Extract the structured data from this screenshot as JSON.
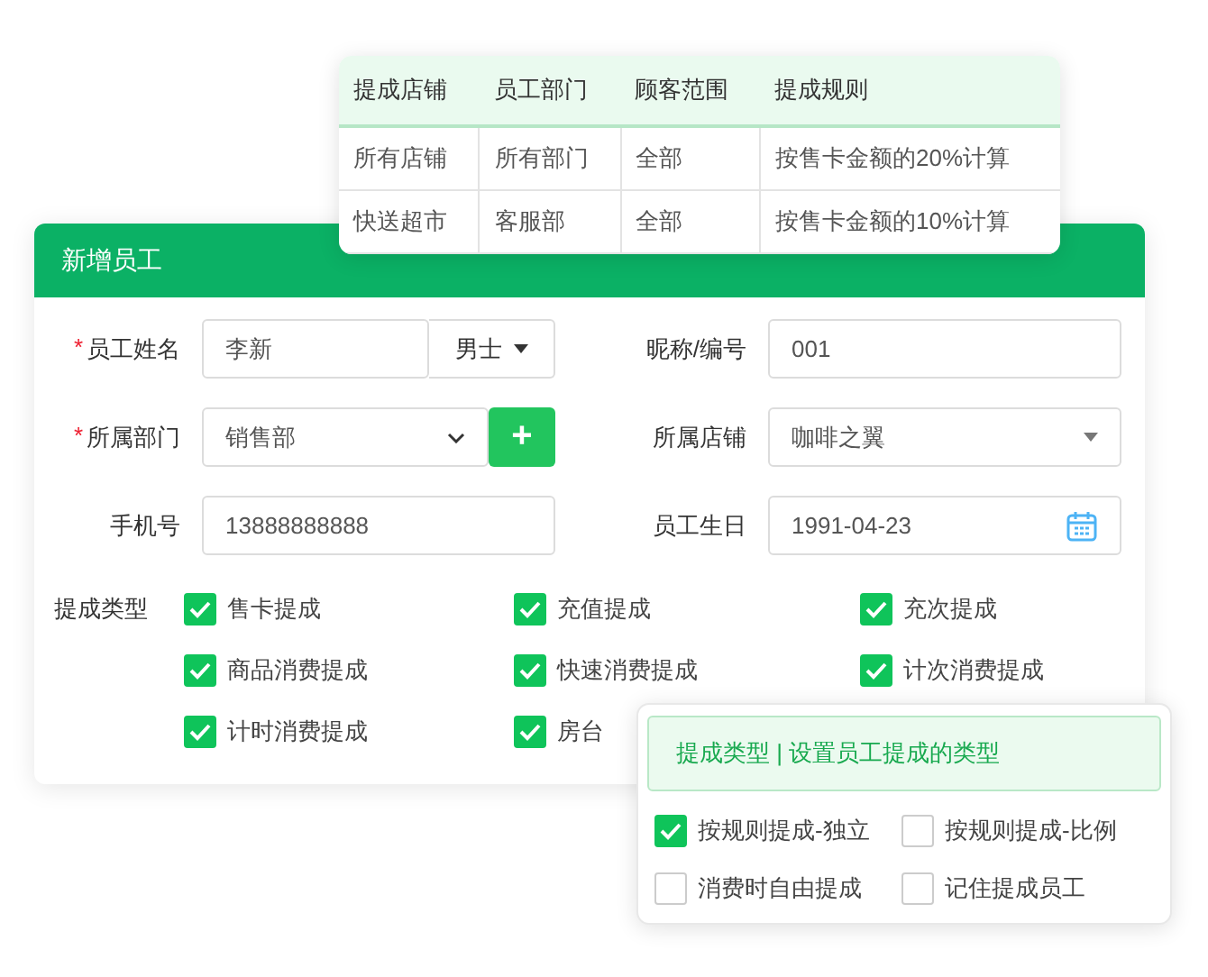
{
  "rules_table": {
    "columns": [
      "提成店铺",
      "员工部门",
      "顾客范围",
      "提成规则"
    ],
    "rows": [
      [
        "所有店铺",
        "所有部门",
        "全部",
        "按售卡金额的20%计算"
      ],
      [
        "快送超市",
        "客服部",
        "全部",
        "按售卡金额的10%计算"
      ]
    ]
  },
  "dialog": {
    "title": "新增员工",
    "fields": [
      {
        "kind": "text_with_select",
        "label": "员工姓名",
        "asterisk": "*",
        "value": "李新",
        "select": "男士"
      },
      {
        "kind": "text",
        "label": "昵称/编号",
        "value": "001"
      },
      {
        "kind": "select_with_add",
        "label": "所属部门",
        "asterisk": "*",
        "value": "销售部",
        "button": "+"
      },
      {
        "kind": "select",
        "label": "所属店铺",
        "value": "咖啡之翼"
      },
      {
        "kind": "text",
        "label": "手机号",
        "value": "13888888888"
      },
      {
        "kind": "date",
        "label": "员工生日",
        "value": "1991-04-23"
      }
    ],
    "commission_label": "提成类型",
    "commission_types": [
      {
        "label": "售卡提成",
        "checked": true
      },
      {
        "label": "充值提成",
        "checked": true
      },
      {
        "label": "充次提成",
        "checked": true
      },
      {
        "label": "商品消费提成",
        "checked": true
      },
      {
        "label": "快速消费提成",
        "checked": true
      },
      {
        "label": "计次消费提成",
        "checked": true
      },
      {
        "label": "计时消费提成",
        "checked": true
      },
      {
        "label": "房台",
        "checked": true
      }
    ]
  },
  "popup": {
    "title": "提成类型 | 设置员工提成的类型",
    "options": [
      {
        "label": "按规则提成-独立",
        "checked": true
      },
      {
        "label": "按规则提成-比例",
        "checked": false
      },
      {
        "label": "消费时自由提成",
        "checked": false
      },
      {
        "label": "记住提成员工",
        "checked": false
      }
    ]
  }
}
